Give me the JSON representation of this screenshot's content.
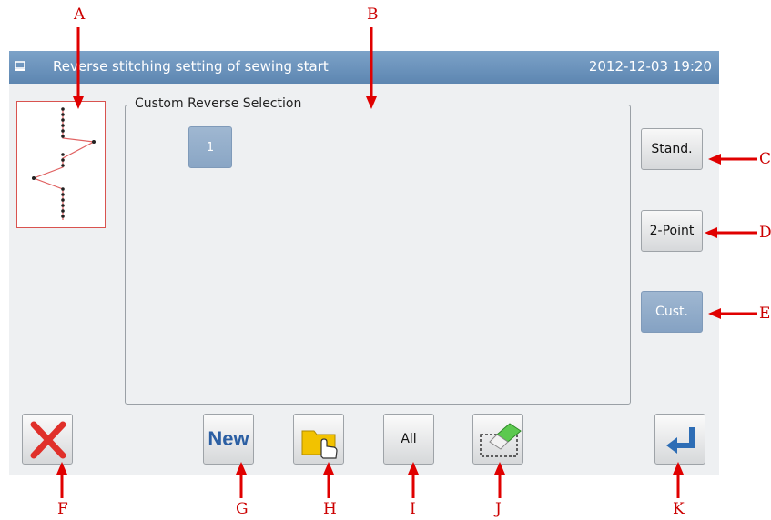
{
  "titlebar": {
    "icon": "monitor-icon",
    "title": "Reverse stitching setting of sewing start",
    "datetime": "2012-12-03  19:20"
  },
  "preview": {
    "icon": "stitch-pattern-icon"
  },
  "custom_section": {
    "legend": "Custom Reverse Selection",
    "patterns": [
      "1"
    ]
  },
  "side_buttons": {
    "standard": "Stand.",
    "two_point": "2-Point",
    "custom": "Cust.",
    "selected": "custom"
  },
  "toolbar": {
    "cancel_icon": "close-icon",
    "new_label": "New",
    "open_icon": "folder-hand-icon",
    "all_label": "All",
    "erase_icon": "eraser-icon",
    "confirm_icon": "enter-return-icon"
  },
  "annotations": {
    "a": "A",
    "b": "B",
    "c": "C",
    "d": "D",
    "e": "E",
    "f": "F",
    "g": "G",
    "h": "H",
    "i": "I",
    "j": "J",
    "k": "K"
  },
  "colors": {
    "titlebar": "#5d86b1",
    "selected_button": "#8aa6c5",
    "annotation_red": "#cc0000",
    "cancel_red": "#e0302a",
    "confirm_blue": "#2d6db5",
    "folder_yellow": "#f2c200",
    "eraser_green": "#5cc94f"
  }
}
